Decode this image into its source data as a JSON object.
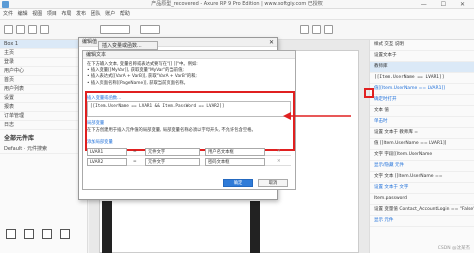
{
  "window": {
    "title": "产品原型_recovered - Axure RP 9 Pro Edition | www.softgiy.com 已授权",
    "controls": "— ☐ ✕"
  },
  "menu": [
    "文件",
    "编辑",
    "视图",
    "项目",
    "布局",
    "发布",
    "团队",
    "账户",
    "帮助"
  ],
  "left_panel": {
    "page_row": "Box 1",
    "rows": [
      "主页",
      "登录",
      "用户中心",
      "首页",
      "用户列表",
      "设置",
      "报表",
      "订单管理",
      "日志"
    ],
    "library_title": "全部元件库",
    "search_placeholder": "Default · 元件搜索"
  },
  "right_panel": {
    "tabs": "样式  交互  说明",
    "property_label": "设置文本于",
    "target": "教师库",
    "sections": [
      "文本  值",
      "单击时",
      "设置 文本于 教师库 =",
      "值  [[Item.UserName == LVAR1]]",
      "文字 字段[[Item.UserName",
      "显示/隐藏 元件",
      "文字 文本 [[Item.UserName ==",
      "设置 文本于 文字",
      "Item.password",
      "设置 变量值 Contact_AccountLogin == \"False\"",
      "显示 元件"
    ],
    "value_text": "[[Item.UserName == LVAR1]]",
    "checkbox_label": "值[[Item.UserName == LVAR1]]",
    "checkbox2": "确定时打开"
  },
  "dialog_outer": {
    "title": "编辑值",
    "close": "✕"
  },
  "insert_button": "插入变量或函数...",
  "dialog_inner": {
    "title": "编辑文本",
    "instructions": [
      "在下方输入文本, 变量名称或表达式要写在\"[[ ]]\"中。例如:",
      "• 插入变量[[MyVar]], 获取变量\"MyVar\"的当前值;",
      "• 插入表达式[[VarA + VarB]], 获取\"VarA + VarB\"的和;",
      "• 插入页面名称[[PageName]], 获取当前页面名称。"
    ],
    "insert_link": "插入变量或函数...",
    "expression": "[[Item.UserName == LVAR1 && Item.PassWord == LVAR2]]",
    "local_vars_title": "局部变量",
    "local_vars_desc": "在下方创建用于插入元件值的局部变量, 局部变量名称必须以字母开头, 不允许包含空格。",
    "add_var": "添加局部变量",
    "vars": [
      {
        "name": "LVAR1",
        "eq": "=",
        "type": "元件文字",
        "target": "用户名文本框"
      },
      {
        "name": "LVAR2",
        "eq": "=",
        "type": "元件文字",
        "target": "密码文本框"
      }
    ],
    "ok": "确定",
    "cancel": "取消"
  },
  "watermark": "CSDN @沈某杰",
  "colors": {
    "highlight": "#e02020",
    "accent": "#2f7bd8"
  }
}
